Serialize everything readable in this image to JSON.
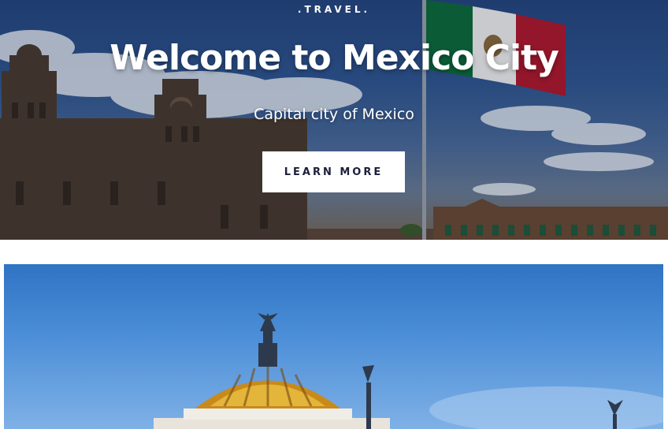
{
  "hero": {
    "brand": ".TRAVEL.",
    "title": "Welcome to Mexico City",
    "subtitle": "Capital city of Mexico",
    "cta_label": "LEARN MORE",
    "image_subject": "cathedral-and-flag-photo"
  },
  "gallery": {
    "image_subject": "palacio-de-bellas-artes-photo"
  },
  "colors": {
    "sky_top": "#24457e",
    "cta_bg": "#ffffff",
    "cta_text": "#1c1f3a",
    "flag_green": "#0b6b3a",
    "flag_red": "#b3162a"
  }
}
